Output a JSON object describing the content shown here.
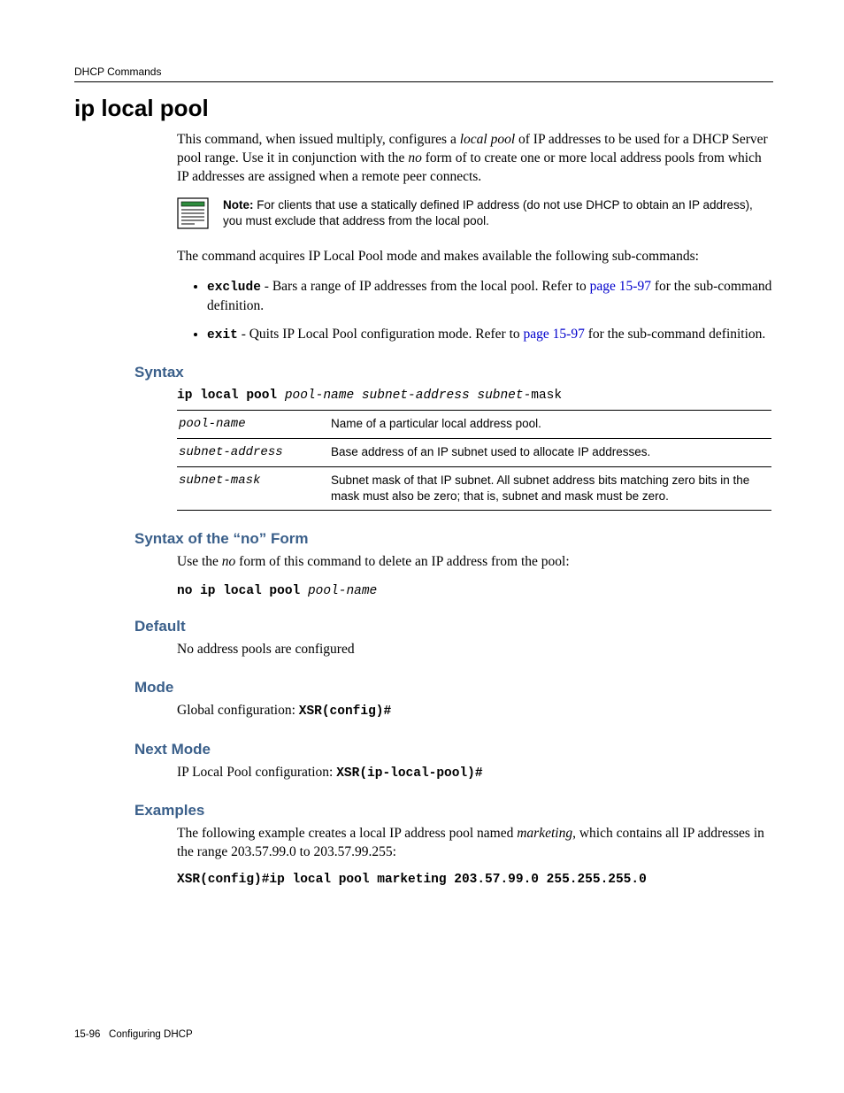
{
  "header": {
    "running_head": "DHCP Commands"
  },
  "title": "ip local pool",
  "intro": {
    "p1_a": "This command, when issued multiply, configures a ",
    "p1_b": "local pool",
    "p1_c": " of IP addresses to be used for a DHCP Server pool range. Use it in conjunction with the ",
    "p1_d": "no",
    "p1_e": " form of to create one or more local address pools from which IP addresses are assigned when a remote peer connects."
  },
  "note": {
    "label": "Note:",
    "text": " For clients that use a statically defined IP address (do not use DHCP to obtain an IP address), you must exclude that address from the local pool."
  },
  "sub_intro": "The command acquires IP Local Pool mode and makes available the following sub-commands:",
  "bullets": [
    {
      "cmd": "exclude",
      "pre": " - Bars a range of IP addresses from the local pool. Refer to ",
      "link": "page 15-97",
      "post": " for the sub-command definition."
    },
    {
      "cmd": "exit",
      "pre": " - Quits IP Local Pool configuration mode. Refer to ",
      "link": "page 15-97",
      "post": " for the sub-command definition."
    }
  ],
  "syntax": {
    "heading": "Syntax",
    "cmd": "ip local pool ",
    "args": "pool-name subnet-address subnet-",
    "args2": "mask",
    "rows": [
      {
        "param": "pool-name",
        "desc": "Name of a particular local address pool."
      },
      {
        "param": "subnet-address",
        "desc": "Base address of an IP subnet used to allocate IP addresses."
      },
      {
        "param": "subnet-mask",
        "desc": "Subnet mask of that IP subnet. All subnet address bits matching zero bits in the mask must also be zero; that is, subnet and mask must be zero."
      }
    ]
  },
  "no_form": {
    "heading": "Syntax of the “no” Form",
    "text_a": "Use the ",
    "text_b": "no",
    "text_c": " form of this command to delete an IP address from the pool:",
    "cmd": "no ip local pool ",
    "arg": "pool-name"
  },
  "default": {
    "heading": "Default",
    "text": "No address pools are configured"
  },
  "mode": {
    "heading": "Mode",
    "text": "Global configuration: ",
    "cmd": "XSR(config)#"
  },
  "next_mode": {
    "heading": "Next Mode",
    "text": "IP Local Pool configuration: ",
    "cmd": "XSR(ip-local-pool)#"
  },
  "examples": {
    "heading": "Examples",
    "text_a": "The following example creates a local IP address pool named ",
    "text_b": "marketing",
    "text_c": ", which contains all IP addresses in the range 203.57.99.0 to 203.57.99.255:",
    "cmd": "XSR(config)#ip local pool marketing 203.57.99.0 255.255.255.0"
  },
  "footer": {
    "page": "15-96",
    "label": "Configuring DHCP"
  }
}
